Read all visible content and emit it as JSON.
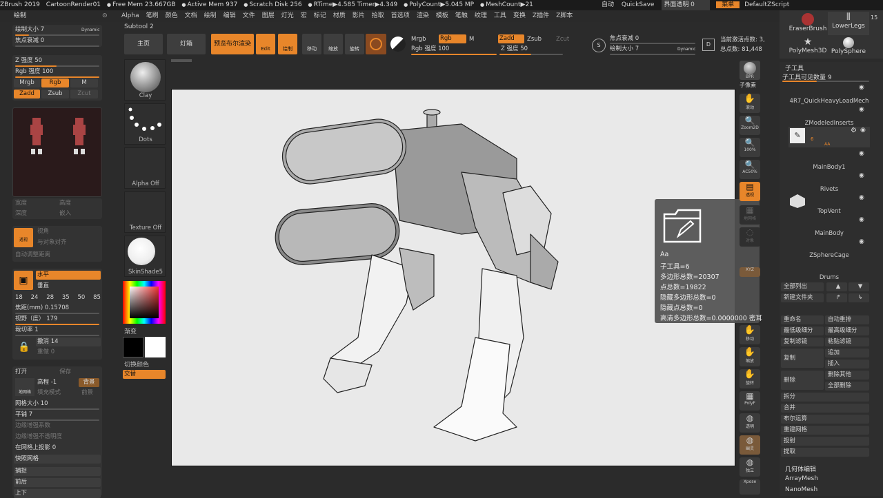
{
  "titlebar": {
    "app": "ZBrush 2019",
    "doc": "CartoonRender01",
    "free_mem": "Free Mem 23.667GB",
    "active_mem": "Active Mem 937",
    "scratch": "Scratch Disk 256",
    "rtime": "RTime▶4.585 Timer▶4.349",
    "polycount": "PolyCount▶5.045 MP",
    "meshcount": "MeshCount▶21",
    "auto": "自动",
    "quicksave": "QuickSave",
    "ui_opacity": "界面透明 0",
    "menu": "菜单",
    "script": "DefaultZScript"
  },
  "menus": [
    "Alpha",
    "笔刷",
    "颜色",
    "文档",
    "绘制",
    "编辑",
    "文件",
    "图层",
    "灯光",
    "宏",
    "标记",
    "材质",
    "影片",
    "拾取",
    "首选项",
    "渲染",
    "模板",
    "笔触",
    "纹理",
    "工具",
    "变换",
    "Z插件",
    "Z脚本"
  ],
  "left_header": "绘制",
  "left": {
    "draw_size": "绘制大小 7",
    "dynamic": "Dynamic",
    "focal_shift": "焦点衰减 0",
    "z_intensity": "Z 强度 50",
    "rgb_intensity": "Rgb 强度 100",
    "mrgb": "Mrgb",
    "rgb": "Rgb",
    "m": "M",
    "zadd": "Zadd",
    "zsub": "Zsub",
    "zcut": "Zcut",
    "width": "宽度",
    "height": "高度",
    "depth": "深度",
    "embed": "嵌入",
    "perspective": "透视",
    "angle": "视角",
    "align_object": "与对象对齐",
    "auto_adjust": "自动调整距离",
    "horizontal": "水平",
    "vertical": "垂直",
    "focal_values": [
      "18",
      "24",
      "28",
      "35",
      "50",
      "85"
    ],
    "focal_mm": "焦距(mm) 0.15708",
    "fov": "视野（度） 179",
    "crop": "裁切率 1",
    "undo": "撤消 14",
    "redo": "重做 0",
    "open": "打开",
    "save": "保存",
    "height_val": "高程 -1",
    "tint": "填充模式",
    "bg": "背景",
    "front": "前景",
    "grid_size": "网格大小 10",
    "smooth": "平铺 7",
    "edge_sensitivity": "边缘增强系数",
    "edge_opacity": "边缘增强不透明度",
    "grid_proj": "在网格上投影 0",
    "snap_grid": "快照网格",
    "capture": "捕捉",
    "front_back": "前后",
    "up_down": "上下",
    "floor_btn": "地网格"
  },
  "tiles": {
    "clay": "Clay",
    "dots": "Dots",
    "alpha_off": "Alpha Off",
    "texture_off": "Texture Off",
    "skinshade": "SkinShade5",
    "gradient": "渐变",
    "switch_color": "切换颜色",
    "alternate": "交替"
  },
  "toolbar": {
    "subtool": "Subtool 2",
    "home": "主页",
    "lightbox": "灯箱",
    "bpr": "预览布尔渲染",
    "edit": "Edit",
    "draw": "绘制",
    "move": "移动",
    "scale": "缩放",
    "rotate": "旋转",
    "mrgb": "Mrgb",
    "rgb": "Rgb",
    "m": "M",
    "zadd": "Zadd",
    "zsub": "Zsub",
    "zcut": "Zcut",
    "rgb_intensity": "Rgb 强度 100",
    "z_intensity": "Z 强度 50",
    "focal_shift": "焦点衰减 0",
    "draw_size": "绘制大小 7",
    "dynamic": "Dynamic",
    "active_points": "当前激活点数: 3,",
    "total_points": "总点数: 81,448"
  },
  "info": {
    "name": "Aa",
    "subtool": "子工具=6",
    "poly_total": "多边形总数=20307",
    "point_total": "点总数=19822",
    "hidden_poly": "隐藏多边形总数=0",
    "hidden_pts": "隐藏点总数=0",
    "hd_poly": "高清多边形总数=0.0000000 密耳"
  },
  "right_tools": [
    "BPR",
    "子像素",
    "滚动",
    "Zoom2D",
    "100%",
    "AC50%",
    "透视",
    "地网格",
    "对象",
    "XYZ",
    "移动",
    "缩放",
    "旋转",
    "PolyF",
    "透明",
    "幽灵",
    "独立",
    "Xpose"
  ],
  "brushes": {
    "eraser": "EraserBrush",
    "lowerlegs": "LowerLegs",
    "lowerlegs_count": "15",
    "polymesh": "PolyMesh3D",
    "polysphere": "PolySphere"
  },
  "subtool_panel": {
    "title": "子工具",
    "visible_count": "子工具可见数量 9",
    "items": [
      "4R7_QuickHeavyLoadMech",
      "ZModeledInserts",
      "6",
      "MainBody1",
      "Rivets",
      "TopVent",
      "MainBody",
      "ZSphereCage",
      "Drums"
    ],
    "sub_label": "AA",
    "list_all": "全部列出",
    "new_folder": "新建文件夹",
    "rename": "重命名",
    "auto_reorder": "自动重排",
    "lowest_sub": "最低级细分",
    "highest_sub": "最高级细分",
    "copy": "复制滤镜",
    "paste": "粘贴滤镜",
    "duplicate": "复制",
    "append": "追加",
    "insert": "插入",
    "delete": "删除",
    "delete_other": "删除其他",
    "delete_all": "全部删除",
    "split": "拆分",
    "merge": "合并",
    "boolean": "布尔运算",
    "remesh": "重建网格",
    "project": "投射",
    "extract": "提取",
    "geometry": "几何体编辑",
    "arraymesh": "ArrayMesh",
    "nanomesh": "NanoMesh"
  },
  "colors": {
    "accent": "#e8862a",
    "panel": "#333333",
    "bg": "#2b2b2b"
  }
}
